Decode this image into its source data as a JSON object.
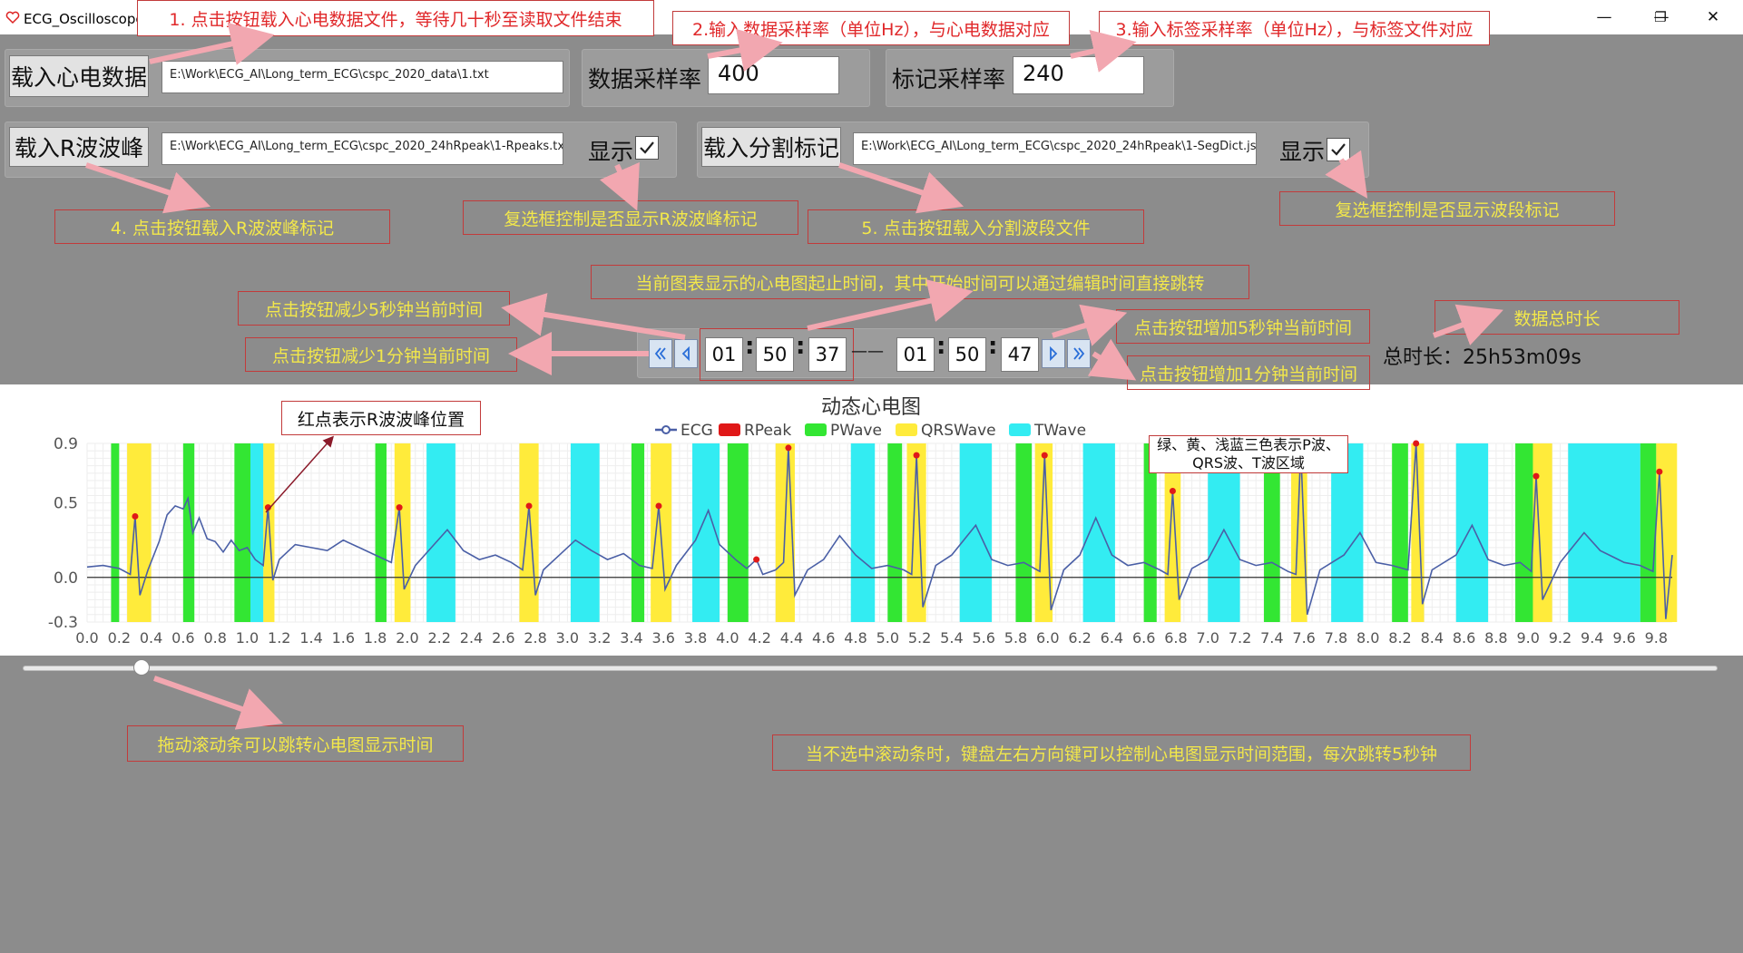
{
  "window": {
    "title": "ECG_Oscilloscope",
    "min": "—",
    "max": "❐",
    "close": "✕"
  },
  "row1": {
    "load_ecg_label": "载入心电数据",
    "ecg_path": "E:\\Work\\ECG_AI\\Long_term_ECG\\cspc_2020_data\\1.txt",
    "data_rate_label": "数据采样率",
    "data_rate_value": "400",
    "mark_rate_label": "标记采样率",
    "mark_rate_value": "240"
  },
  "row2": {
    "load_rpeak_label": "载入R波波峰",
    "rpeak_path": "E:\\Work\\ECG_AI\\Long_term_ECG\\cspc_2020_24hRpeak\\1-Rpeaks.txt",
    "show_label_1": "显示",
    "show_checked_1": true,
    "load_seg_label": "载入分割标记",
    "seg_path": "E:\\Work\\ECG_AI\\Long_term_ECG\\cspc_2020_24hRpeak\\1-SegDict.json",
    "show_label_2": "显示",
    "show_checked_2": true
  },
  "time": {
    "start_h": "01",
    "start_m": "50",
    "start_s": "37",
    "end_h": "01",
    "end_m": "50",
    "end_s": "47",
    "colon": ":",
    "dash": "——",
    "total_label": "总时长：25h53m09s"
  },
  "annotations": {
    "a1": "1. 点击按钮载入心电数据文件，等待几十秒至读取文件结束",
    "a2": "2.输入数据采样率（单位Hz），与心电数据对应",
    "a3": "3.输入标签采样率（单位Hz），与标签文件对应",
    "a4": "4. 点击按钮载入R波波峰标记",
    "a_cb1": "复选框控制是否显示R波波峰标记",
    "a5": "5. 点击按钮载入分割波段文件",
    "a_cb2": "复选框控制是否显示波段标记",
    "a_time": "当前图表显示的心电图起止时间，其中开始时间可以通过编辑时间直接跳转",
    "a_m5s": "点击按钮减少5秒钟当前时间",
    "a_m1m": "点击按钮减少1分钟当前时间",
    "a_p5s": "点击按钮增加5秒钟当前时间",
    "a_p1m": "点击按钮增加1分钟当前时间",
    "a_total": "数据总时长",
    "a_rpeak": "红点表示R波波峰位置",
    "a_colors": "绿、黄、浅蓝三色表示P波、QRS波、T波区域",
    "a_slider": "拖动滚动条可以跳转心电图显示时间",
    "a_keys": "当不选中滚动条时，键盘左右方向键可以控制心电图显示时间范围，每次跳转5秒钟"
  },
  "colors": {
    "p": "#33e633",
    "qrs": "#ffeb3b",
    "t": "#33ecf2",
    "ecg": "#4a5fa6",
    "rpeak": "#e01818"
  },
  "slider": {
    "value_fraction": 0.07
  },
  "chart_data": {
    "type": "line",
    "title": "动态心电图",
    "legend": [
      "ECG",
      "RPeak",
      "PWave",
      "QRSWave",
      "TWave"
    ],
    "xlim": [
      0,
      9.9
    ],
    "ylim": [
      -0.3,
      0.9
    ],
    "yticks": [
      "0.9",
      "0.5",
      "0.0",
      "-0.3"
    ],
    "ytick_values": [
      0.9,
      0.5,
      0.0,
      -0.3
    ],
    "xticks": [
      "0.0",
      "0.2",
      "0.4",
      "0.6",
      "0.8",
      "1.0",
      "1.2",
      "1.4",
      "1.6",
      "1.8",
      "2.0",
      "2.2",
      "2.4",
      "2.6",
      "2.8",
      "3.0",
      "3.2",
      "3.4",
      "3.6",
      "3.8",
      "4.0",
      "4.2",
      "4.4",
      "4.6",
      "4.8",
      "5.0",
      "5.2",
      "5.4",
      "5.6",
      "5.8",
      "6.0",
      "6.2",
      "6.4",
      "6.6",
      "6.8",
      "7.0",
      "7.2",
      "7.4",
      "7.6",
      "7.8",
      "8.0",
      "8.2",
      "8.4",
      "8.6",
      "8.8",
      "9.0",
      "9.2",
      "9.4",
      "9.6",
      "9.8"
    ],
    "rpeaks": [
      [
        0.3,
        0.41
      ],
      [
        1.13,
        0.47
      ],
      [
        1.95,
        0.47
      ],
      [
        2.76,
        0.48
      ],
      [
        3.57,
        0.48
      ],
      [
        4.18,
        0.12
      ],
      [
        4.38,
        0.87
      ],
      [
        5.18,
        0.82
      ],
      [
        5.98,
        0.82
      ],
      [
        6.78,
        0.58
      ],
      [
        7.58,
        0.86
      ],
      [
        8.3,
        0.9
      ],
      [
        9.05,
        0.68
      ],
      [
        9.82,
        0.71
      ]
    ],
    "pwave": [
      [
        0.15,
        0.2
      ],
      [
        0.6,
        0.67
      ],
      [
        0.92,
        1.02
      ],
      [
        1.8,
        1.87
      ],
      [
        3.4,
        3.48
      ],
      [
        4.0,
        4.13
      ],
      [
        5.0,
        5.09
      ],
      [
        5.8,
        5.9
      ],
      [
        6.6,
        6.68
      ],
      [
        7.35,
        7.45
      ],
      [
        8.15,
        8.25
      ],
      [
        8.92,
        9.03
      ],
      [
        9.7,
        9.8
      ]
    ],
    "qrs": [
      [
        0.25,
        0.4
      ],
      [
        1.1,
        1.17
      ],
      [
        1.92,
        2.02
      ],
      [
        2.7,
        2.82
      ],
      [
        3.52,
        3.65
      ],
      [
        4.3,
        4.42
      ],
      [
        5.12,
        5.24
      ],
      [
        5.92,
        6.03
      ],
      [
        6.73,
        6.83
      ],
      [
        7.52,
        7.62
      ],
      [
        8.27,
        8.35
      ],
      [
        9.03,
        9.15
      ],
      [
        9.8,
        9.93
      ]
    ],
    "twave": [
      [
        1.02,
        1.1
      ],
      [
        2.12,
        2.3
      ],
      [
        3.02,
        3.2
      ],
      [
        3.78,
        3.95
      ],
      [
        4.77,
        4.92
      ],
      [
        5.45,
        5.65
      ],
      [
        6.22,
        6.42
      ],
      [
        7.0,
        7.2
      ],
      [
        7.77,
        7.97
      ],
      [
        8.55,
        8.75
      ],
      [
        9.25,
        9.7
      ]
    ],
    "ecg": [
      [
        0.0,
        0.07
      ],
      [
        0.1,
        0.08
      ],
      [
        0.2,
        0.06
      ],
      [
        0.27,
        0.02
      ],
      [
        0.3,
        0.41
      ],
      [
        0.33,
        -0.12
      ],
      [
        0.38,
        0.05
      ],
      [
        0.45,
        0.24
      ],
      [
        0.5,
        0.42
      ],
      [
        0.55,
        0.48
      ],
      [
        0.6,
        0.46
      ],
      [
        0.63,
        0.53
      ],
      [
        0.66,
        0.3
      ],
      [
        0.7,
        0.4
      ],
      [
        0.75,
        0.26
      ],
      [
        0.8,
        0.24
      ],
      [
        0.85,
        0.17
      ],
      [
        0.9,
        0.25
      ],
      [
        0.95,
        0.18
      ],
      [
        1.0,
        0.2
      ],
      [
        1.05,
        0.12
      ],
      [
        1.1,
        0.08
      ],
      [
        1.13,
        0.47
      ],
      [
        1.16,
        -0.02
      ],
      [
        1.2,
        0.12
      ],
      [
        1.3,
        0.22
      ],
      [
        1.4,
        0.2
      ],
      [
        1.5,
        0.18
      ],
      [
        1.6,
        0.25
      ],
      [
        1.7,
        0.2
      ],
      [
        1.8,
        0.15
      ],
      [
        1.9,
        0.1
      ],
      [
        1.95,
        0.47
      ],
      [
        1.98,
        -0.08
      ],
      [
        2.05,
        0.08
      ],
      [
        2.15,
        0.2
      ],
      [
        2.25,
        0.32
      ],
      [
        2.35,
        0.18
      ],
      [
        2.45,
        0.12
      ],
      [
        2.55,
        0.15
      ],
      [
        2.65,
        0.1
      ],
      [
        2.72,
        0.05
      ],
      [
        2.76,
        0.48
      ],
      [
        2.8,
        -0.12
      ],
      [
        2.85,
        0.05
      ],
      [
        2.95,
        0.15
      ],
      [
        3.05,
        0.25
      ],
      [
        3.15,
        0.18
      ],
      [
        3.25,
        0.12
      ],
      [
        3.35,
        0.16
      ],
      [
        3.45,
        0.08
      ],
      [
        3.53,
        0.06
      ],
      [
        3.57,
        0.48
      ],
      [
        3.61,
        -0.08
      ],
      [
        3.68,
        0.08
      ],
      [
        3.8,
        0.25
      ],
      [
        3.88,
        0.45
      ],
      [
        3.95,
        0.22
      ],
      [
        4.05,
        0.12
      ],
      [
        4.12,
        0.06
      ],
      [
        4.18,
        0.12
      ],
      [
        4.22,
        0.02
      ],
      [
        4.3,
        0.05
      ],
      [
        4.35,
        0.1
      ],
      [
        4.38,
        0.87
      ],
      [
        4.42,
        -0.12
      ],
      [
        4.5,
        0.05
      ],
      [
        4.6,
        0.12
      ],
      [
        4.7,
        0.28
      ],
      [
        4.8,
        0.15
      ],
      [
        4.9,
        0.06
      ],
      [
        5.0,
        0.08
      ],
      [
        5.1,
        0.05
      ],
      [
        5.15,
        0.02
      ],
      [
        5.18,
        0.82
      ],
      [
        5.22,
        -0.2
      ],
      [
        5.3,
        0.08
      ],
      [
        5.4,
        0.15
      ],
      [
        5.55,
        0.35
      ],
      [
        5.65,
        0.12
      ],
      [
        5.75,
        0.08
      ],
      [
        5.85,
        0.1
      ],
      [
        5.95,
        0.04
      ],
      [
        5.98,
        0.82
      ],
      [
        6.02,
        -0.22
      ],
      [
        6.1,
        0.05
      ],
      [
        6.2,
        0.15
      ],
      [
        6.3,
        0.4
      ],
      [
        6.4,
        0.15
      ],
      [
        6.5,
        0.08
      ],
      [
        6.6,
        0.1
      ],
      [
        6.7,
        0.05
      ],
      [
        6.75,
        0.02
      ],
      [
        6.78,
        0.58
      ],
      [
        6.82,
        -0.15
      ],
      [
        6.9,
        0.06
      ],
      [
        7.0,
        0.12
      ],
      [
        7.1,
        0.32
      ],
      [
        7.2,
        0.12
      ],
      [
        7.3,
        0.08
      ],
      [
        7.4,
        0.1
      ],
      [
        7.5,
        0.04
      ],
      [
        7.55,
        0.02
      ],
      [
        7.58,
        0.86
      ],
      [
        7.62,
        -0.25
      ],
      [
        7.7,
        0.05
      ],
      [
        7.85,
        0.15
      ],
      [
        7.95,
        0.3
      ],
      [
        8.05,
        0.1
      ],
      [
        8.15,
        0.08
      ],
      [
        8.25,
        0.05
      ],
      [
        8.3,
        0.9
      ],
      [
        8.34,
        -0.18
      ],
      [
        8.4,
        0.05
      ],
      [
        8.55,
        0.15
      ],
      [
        8.65,
        0.35
      ],
      [
        8.75,
        0.12
      ],
      [
        8.85,
        0.08
      ],
      [
        8.95,
        0.1
      ],
      [
        9.02,
        0.04
      ],
      [
        9.05,
        0.68
      ],
      [
        9.09,
        -0.15
      ],
      [
        9.2,
        0.1
      ],
      [
        9.35,
        0.3
      ],
      [
        9.45,
        0.18
      ],
      [
        9.6,
        0.1
      ],
      [
        9.7,
        0.08
      ],
      [
        9.78,
        0.04
      ],
      [
        9.82,
        0.71
      ],
      [
        9.86,
        -0.28
      ],
      [
        9.9,
        0.15
      ]
    ]
  }
}
